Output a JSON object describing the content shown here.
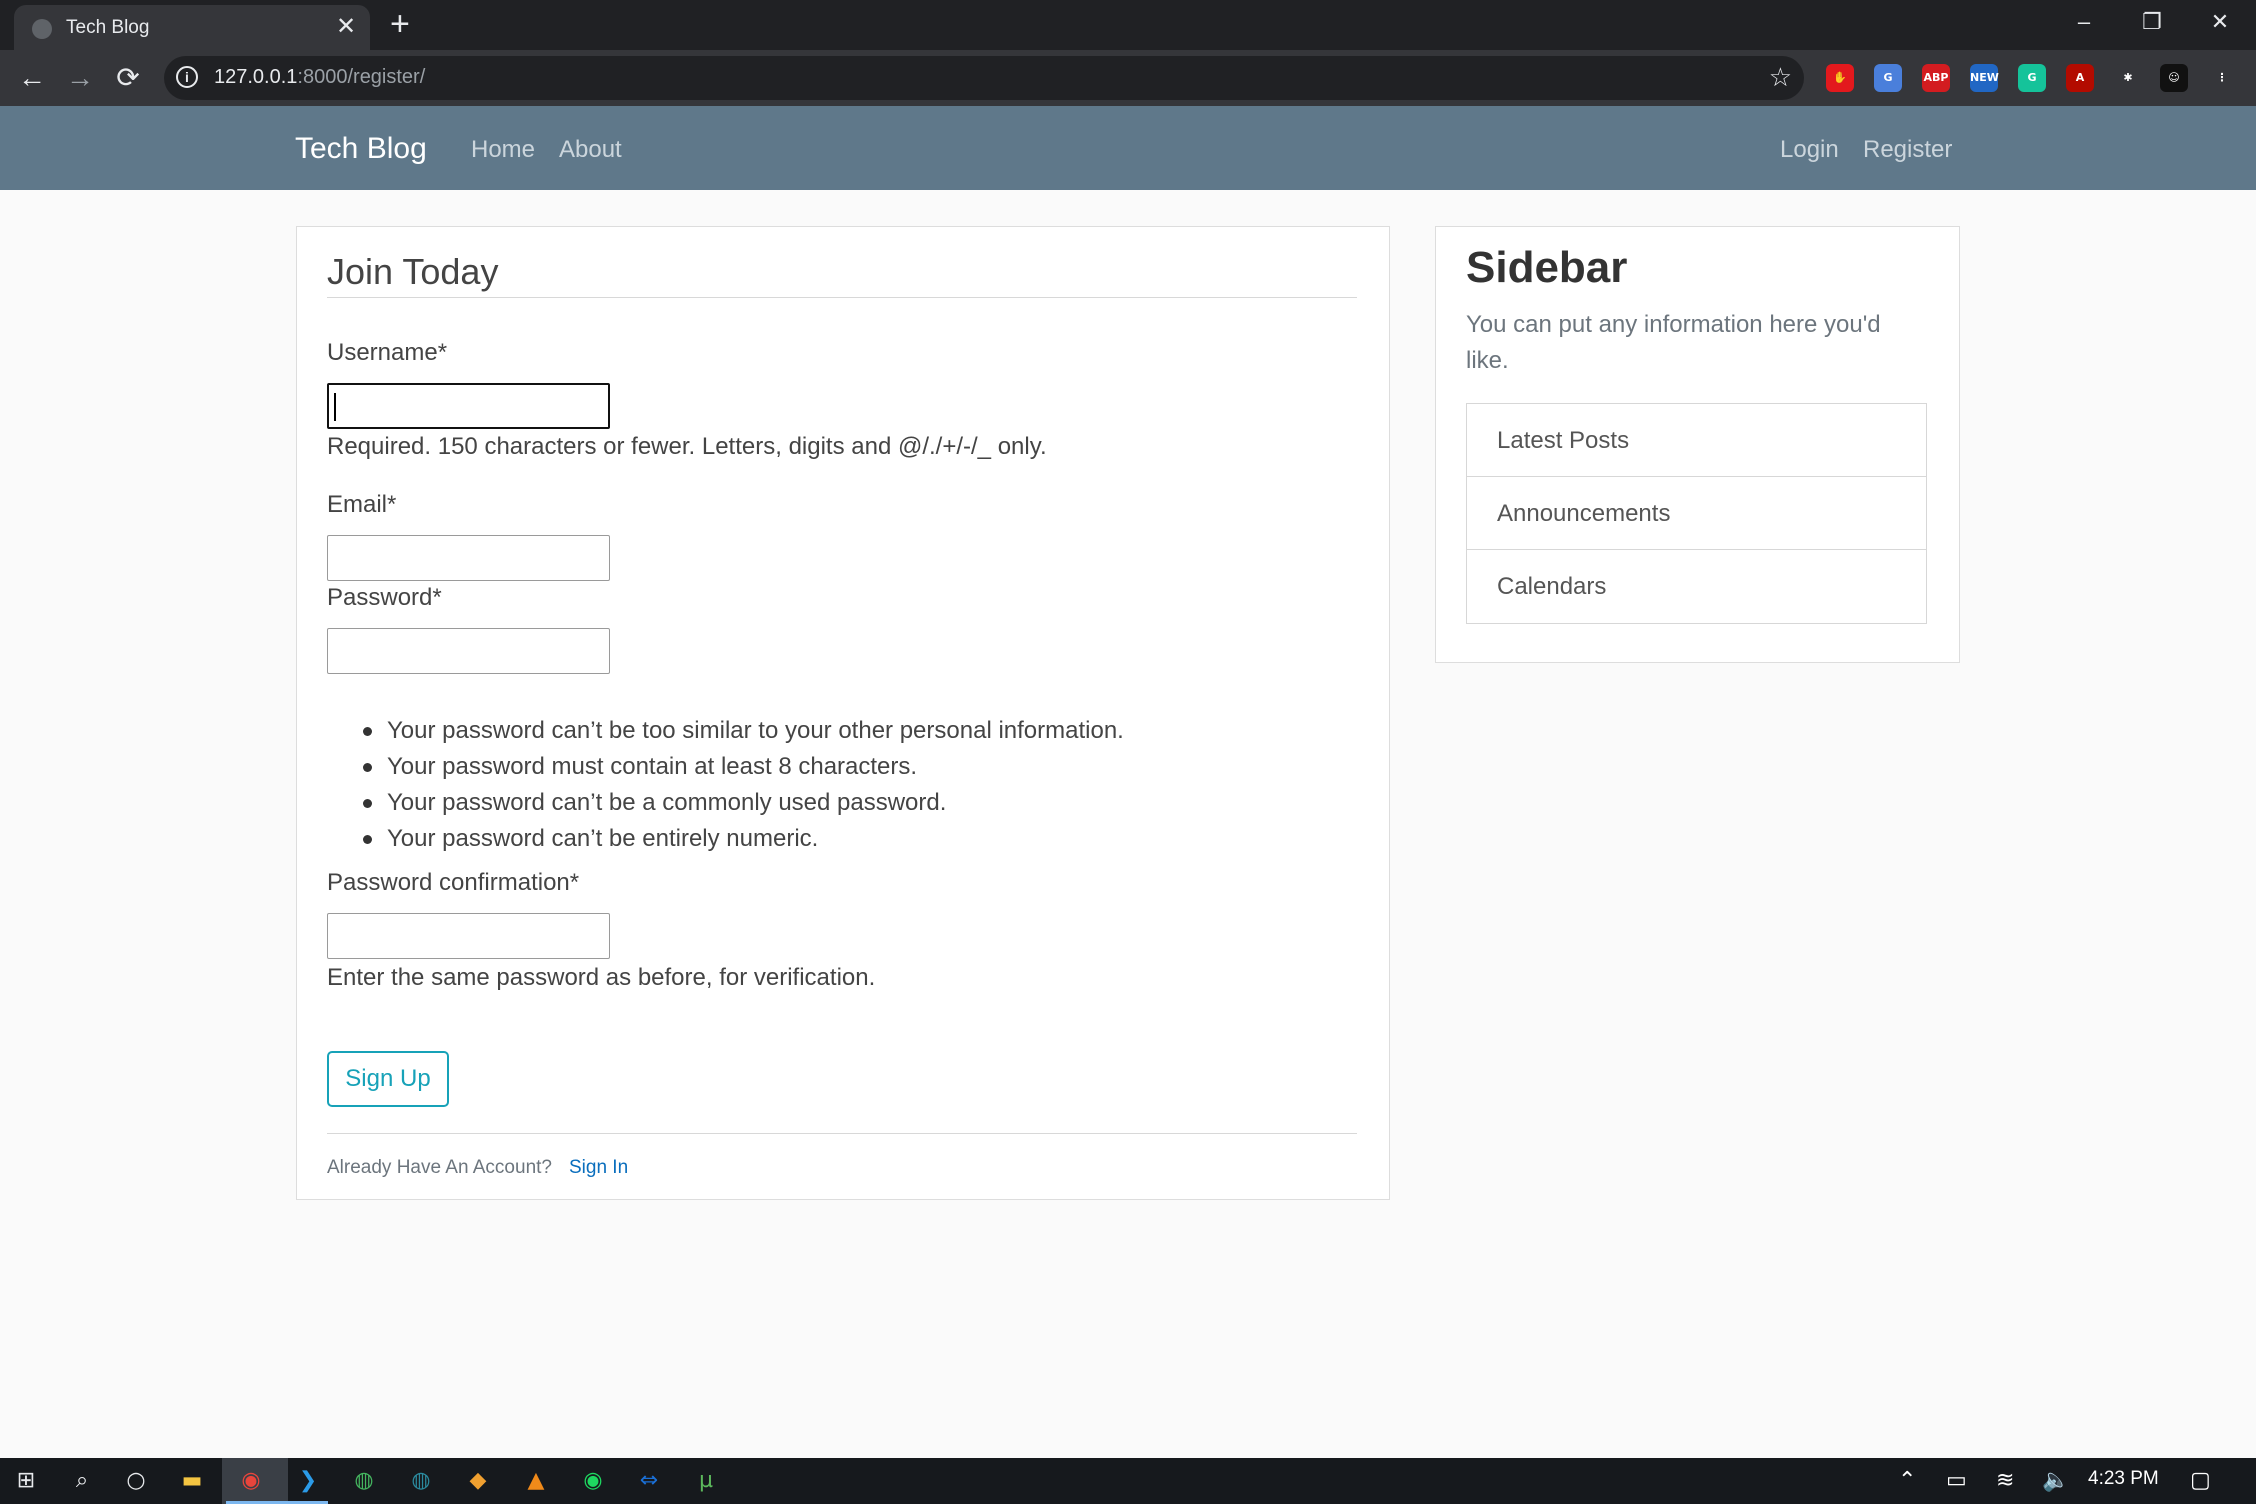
{
  "browser": {
    "tab_title": "Tech Blog",
    "tab_close": "✕",
    "new_tab": "+",
    "url_host": "127.0.0.1",
    "url_rest": ":8000/register/",
    "window_min": "–",
    "window_restore": "❐",
    "window_close": "✕",
    "back": "←",
    "forward": "→",
    "reload": "⟳",
    "info": "i",
    "bookmark": "☆",
    "extensions": [
      {
        "name": "hand-stop-extension-icon",
        "label": "✋",
        "color": "#e3191d"
      },
      {
        "name": "google-translate-extension-icon",
        "label": "G",
        "color": "#4a7fdb"
      },
      {
        "name": "adblock-plus-extension-icon",
        "label": "ABP",
        "color": "#d31c20"
      },
      {
        "name": "new-badge-extension-icon",
        "label": "NEW",
        "color": "#2167c4"
      },
      {
        "name": "grammarly-extension-icon",
        "label": "G",
        "color": "#15c39a"
      },
      {
        "name": "acrobat-extension-icon",
        "label": "A",
        "color": "#b30b00"
      },
      {
        "name": "puzzle-extensions-icon",
        "label": "✱",
        "color": "#35363a"
      },
      {
        "name": "profile-avatar-icon",
        "label": "☺",
        "color": "#111111"
      },
      {
        "name": "menu-kebab-icon",
        "label": "⋮",
        "color": "#35363a"
      }
    ]
  },
  "navbar": {
    "brand": "Tech Blog",
    "home": "Home",
    "about": "About",
    "login": "Login",
    "register": "Register"
  },
  "form": {
    "legend": "Join Today",
    "username_label": "Username*",
    "username_value": "",
    "username_help": "Required. 150 characters or fewer. Letters, digits and @/./+/-/_ only.",
    "email_label": "Email*",
    "email_value": "",
    "password_label": "Password*",
    "password_value": "",
    "password_rules": [
      "Your password can’t be too similar to your other personal information.",
      "Your password must contain at least 8 characters.",
      "Your password can’t be a commonly used password.",
      "Your password can’t be entirely numeric."
    ],
    "confirm_label": "Password confirmation*",
    "confirm_value": "",
    "confirm_help": "Enter the same password as before, for verification.",
    "submit": "Sign Up",
    "account_prompt": "Already Have An Account?",
    "sign_in": "Sign In"
  },
  "sidebar": {
    "title": "Sidebar",
    "text": "You can put any information here you'd like.",
    "items": [
      "Latest Posts",
      "Announcements",
      "Calendars"
    ]
  },
  "taskbar": {
    "start": "⊞",
    "search": "⌕",
    "cortana": "○",
    "apps": [
      {
        "name": "file-explorer-icon",
        "glyph": "▬",
        "color": "#f4c542"
      },
      {
        "name": "chrome-icon",
        "glyph": "◉",
        "color": "#e8453c"
      },
      {
        "name": "vscode-icon",
        "glyph": "❯",
        "color": "#2b9be8"
      },
      {
        "name": "anaconda-icon",
        "glyph": "◍",
        "color": "#44b55f"
      },
      {
        "name": "app-icon",
        "glyph": "◍",
        "color": "#2b8a9e"
      },
      {
        "name": "git-icon",
        "glyph": "◆",
        "color": "#f0a030"
      },
      {
        "name": "vlc-icon",
        "glyph": "▲",
        "color": "#f08a1a"
      },
      {
        "name": "spotify-icon",
        "glyph": "◉",
        "color": "#1ed760"
      },
      {
        "name": "teamviewer-icon",
        "glyph": "⇔",
        "color": "#1a6fd6"
      },
      {
        "name": "utorrent-icon",
        "glyph": "µ",
        "color": "#5cb85c"
      }
    ],
    "tray_chevron": "⌃",
    "battery": "▭",
    "wifi": "≋",
    "volume": "🔈",
    "time": "4:23 PM",
    "notifications": "▢"
  },
  "colors": {
    "navbar_bg": "#5f788a",
    "accent": "#17a2b8",
    "link": "#0a6ebd"
  }
}
